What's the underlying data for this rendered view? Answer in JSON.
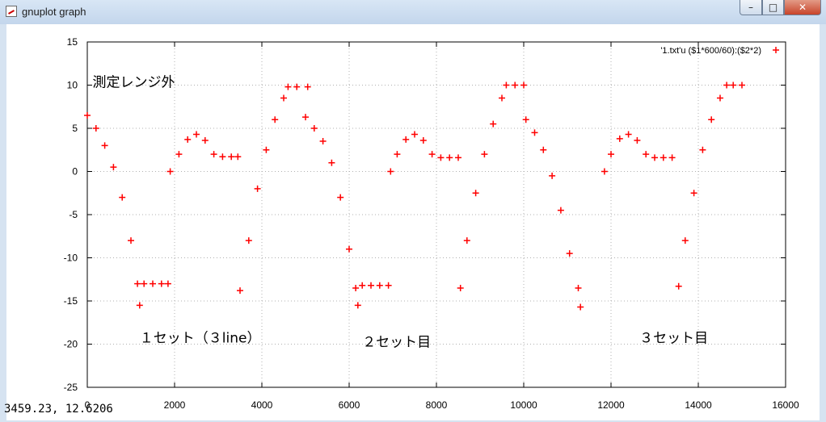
{
  "window": {
    "title": "gnuplot graph",
    "buttons": {
      "minimize": "–",
      "maximize": "□",
      "close": "✕"
    },
    "icon": "gnuplot-app-icon"
  },
  "status_bar": {
    "coordinates": "3459.23, 12.6206"
  },
  "chart_data": {
    "type": "scatter",
    "title": "",
    "xlabel": "",
    "ylabel": "",
    "xlim": [
      0,
      16000
    ],
    "ylim": [
      -25,
      15
    ],
    "xticks": [
      0,
      2000,
      4000,
      6000,
      8000,
      10000,
      12000,
      14000,
      16000
    ],
    "yticks": [
      -25,
      -20,
      -15,
      -10,
      -5,
      0,
      5,
      10,
      15
    ],
    "grid": true,
    "legend": {
      "position": "top-right",
      "entry": "'1.txt'u ($1*600/60):($2*2)"
    },
    "series": [
      {
        "name": "'1.txt'u ($1*600/60):($2*2)",
        "color": "#ff0000",
        "marker": "plus",
        "points": [
          [
            0,
            6.5
          ],
          [
            200,
            5.0
          ],
          [
            400,
            3.0
          ],
          [
            600,
            0.5
          ],
          [
            800,
            -3.0
          ],
          [
            1000,
            -8.0
          ],
          [
            1150,
            -13.0
          ],
          [
            1200,
            -15.5
          ],
          [
            1300,
            -13.0
          ],
          [
            1500,
            -13.0
          ],
          [
            1700,
            -13.0
          ],
          [
            1850,
            -13.0
          ],
          [
            1900,
            0.0
          ],
          [
            2100,
            2.0
          ],
          [
            2300,
            3.7
          ],
          [
            2500,
            4.3
          ],
          [
            2700,
            3.6
          ],
          [
            2900,
            2.0
          ],
          [
            3100,
            1.7
          ],
          [
            3300,
            1.7
          ],
          [
            3450,
            1.7
          ],
          [
            3500,
            -13.8
          ],
          [
            3700,
            -8.0
          ],
          [
            3900,
            -2.0
          ],
          [
            4100,
            2.5
          ],
          [
            4300,
            6.0
          ],
          [
            4500,
            8.5
          ],
          [
            4600,
            9.8
          ],
          [
            4800,
            9.8
          ],
          [
            5050,
            9.8
          ],
          [
            5000,
            6.3
          ],
          [
            5200,
            5.0
          ],
          [
            5400,
            3.5
          ],
          [
            5600,
            1.0
          ],
          [
            5800,
            -3.0
          ],
          [
            6000,
            -9.0
          ],
          [
            6150,
            -13.5
          ],
          [
            6200,
            -15.5
          ],
          [
            6300,
            -13.2
          ],
          [
            6500,
            -13.2
          ],
          [
            6700,
            -13.2
          ],
          [
            6900,
            -13.2
          ],
          [
            6950,
            0.0
          ],
          [
            7100,
            2.0
          ],
          [
            7300,
            3.7
          ],
          [
            7500,
            4.3
          ],
          [
            7700,
            3.6
          ],
          [
            7900,
            2.0
          ],
          [
            8100,
            1.6
          ],
          [
            8300,
            1.6
          ],
          [
            8500,
            1.6
          ],
          [
            8550,
            -13.5
          ],
          [
            8700,
            -8.0
          ],
          [
            8900,
            -2.5
          ],
          [
            9100,
            2.0
          ],
          [
            9300,
            5.5
          ],
          [
            9500,
            8.5
          ],
          [
            9600,
            10.0
          ],
          [
            9800,
            10.0
          ],
          [
            10000,
            10.0
          ],
          [
            10050,
            6.0
          ],
          [
            10250,
            4.5
          ],
          [
            10450,
            2.5
          ],
          [
            10650,
            -0.5
          ],
          [
            10850,
            -4.5
          ],
          [
            11050,
            -9.5
          ],
          [
            11250,
            -13.5
          ],
          [
            11300,
            -15.7
          ],
          [
            11850,
            0.0
          ],
          [
            12000,
            2.0
          ],
          [
            12200,
            3.8
          ],
          [
            12400,
            4.3
          ],
          [
            12600,
            3.6
          ],
          [
            12800,
            2.0
          ],
          [
            13000,
            1.6
          ],
          [
            13200,
            1.6
          ],
          [
            13400,
            1.6
          ],
          [
            13550,
            -13.3
          ],
          [
            13700,
            -8.0
          ],
          [
            13900,
            -2.5
          ],
          [
            14100,
            2.5
          ],
          [
            14300,
            6.0
          ],
          [
            14500,
            8.5
          ],
          [
            14650,
            10.0
          ],
          [
            14800,
            10.0
          ],
          [
            15000,
            10.0
          ]
        ]
      }
    ],
    "annotations": [
      {
        "text": "測定レンジ外",
        "x": 120,
        "y": 9.8
      },
      {
        "text": "１セット（３line）",
        "x": 1200,
        "y": -19.8
      },
      {
        "text": "２セット目",
        "x": 6300,
        "y": -20.3
      },
      {
        "text": "３セット目",
        "x": 12650,
        "y": -19.8
      }
    ]
  }
}
